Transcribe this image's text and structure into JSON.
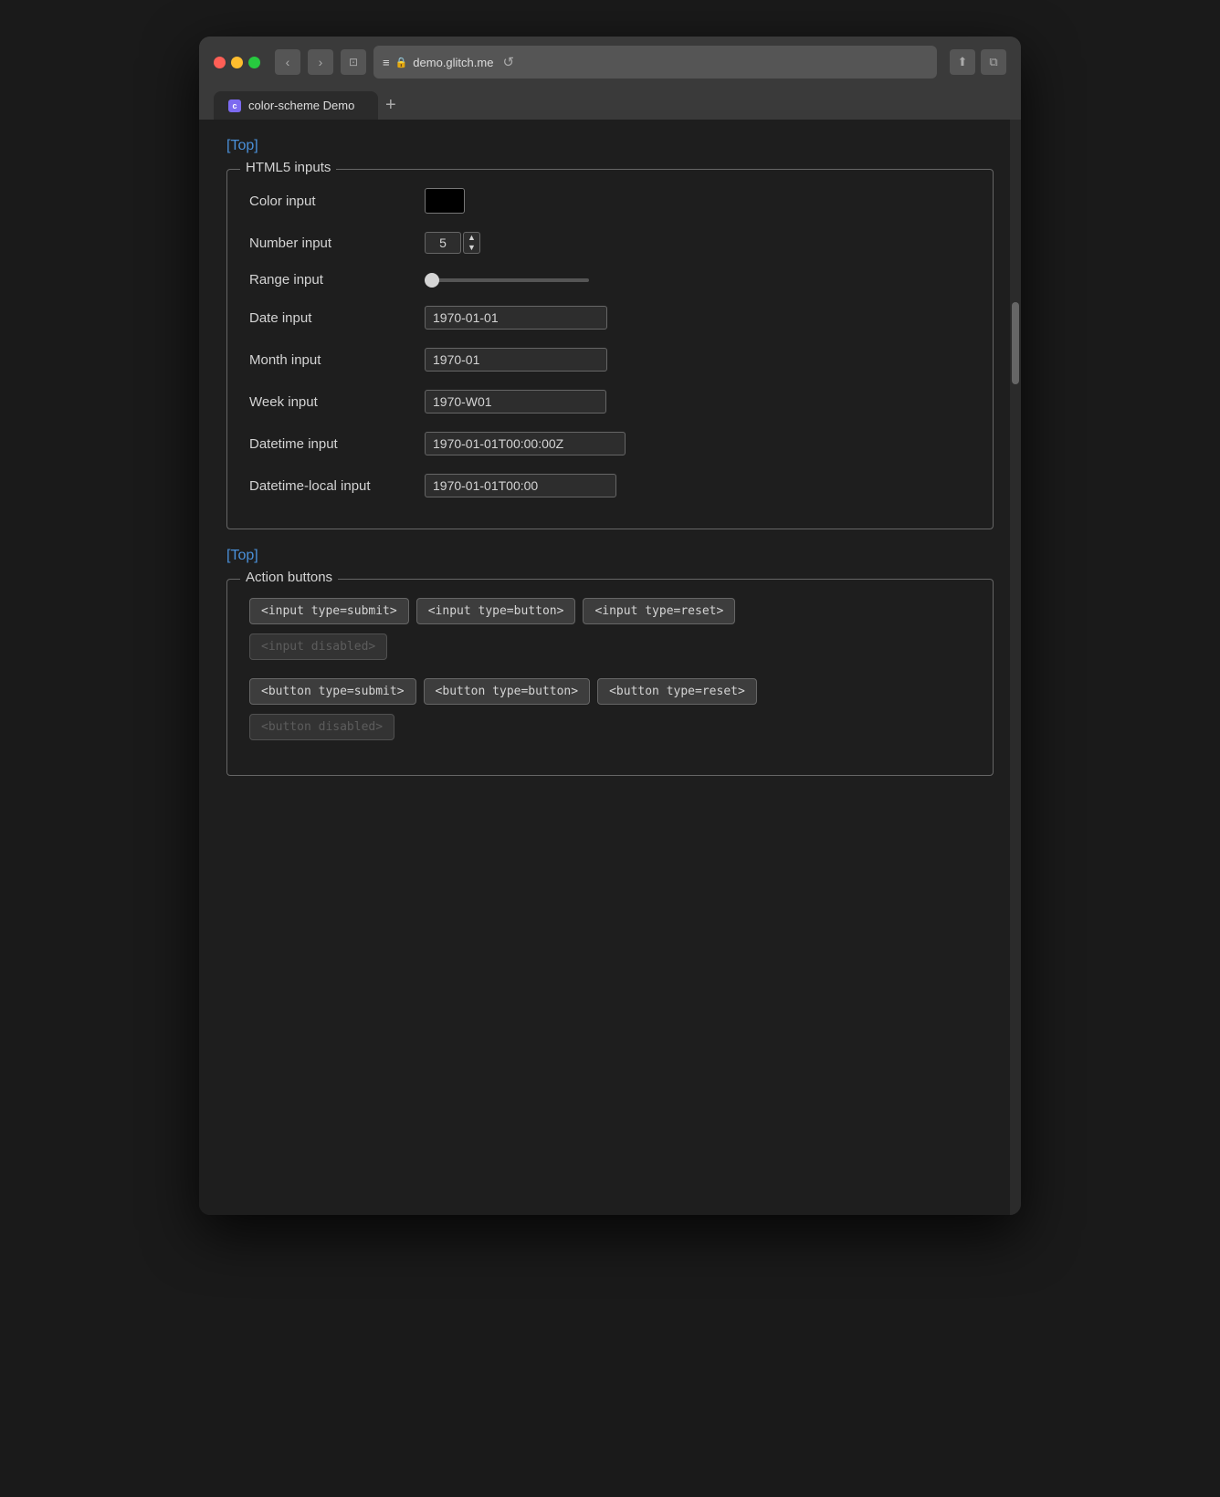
{
  "browser": {
    "url": "demo.glitch.me",
    "tab_title": "color-scheme Demo",
    "tab_favicon_letter": "c"
  },
  "nav": {
    "back": "‹",
    "forward": "›",
    "sidebar": "⊡",
    "menu": "≡",
    "reload": "↺",
    "share": "⬆",
    "windows": "⧉",
    "new_tab": "+"
  },
  "page": {
    "top_link": "[Top]",
    "html5_section_title": "HTML5 inputs",
    "color_label": "Color input",
    "number_label": "Number input",
    "number_value": "5",
    "range_label": "Range input",
    "date_label": "Date input",
    "date_value": "1970-01-01",
    "month_label": "Month input",
    "month_value": "1970-01",
    "week_label": "Week input",
    "week_value": "1970-W01",
    "datetime_label": "Datetime input",
    "datetime_value": "1970-01-01T00:00:00Z",
    "datetime_local_label": "Datetime-local input",
    "datetime_local_value": "1970-01-01T00:00",
    "top_link2": "[Top]",
    "action_section_title": "Action buttons",
    "buttons": {
      "input_submit": "<input type=submit>",
      "input_button": "<input type=button>",
      "input_reset": "<input type=reset>",
      "input_disabled": "<input disabled>",
      "button_submit": "<button type=submit>",
      "button_button": "<button type=button>",
      "button_reset": "<button type=reset>",
      "button_disabled": "<button disabled>"
    }
  }
}
